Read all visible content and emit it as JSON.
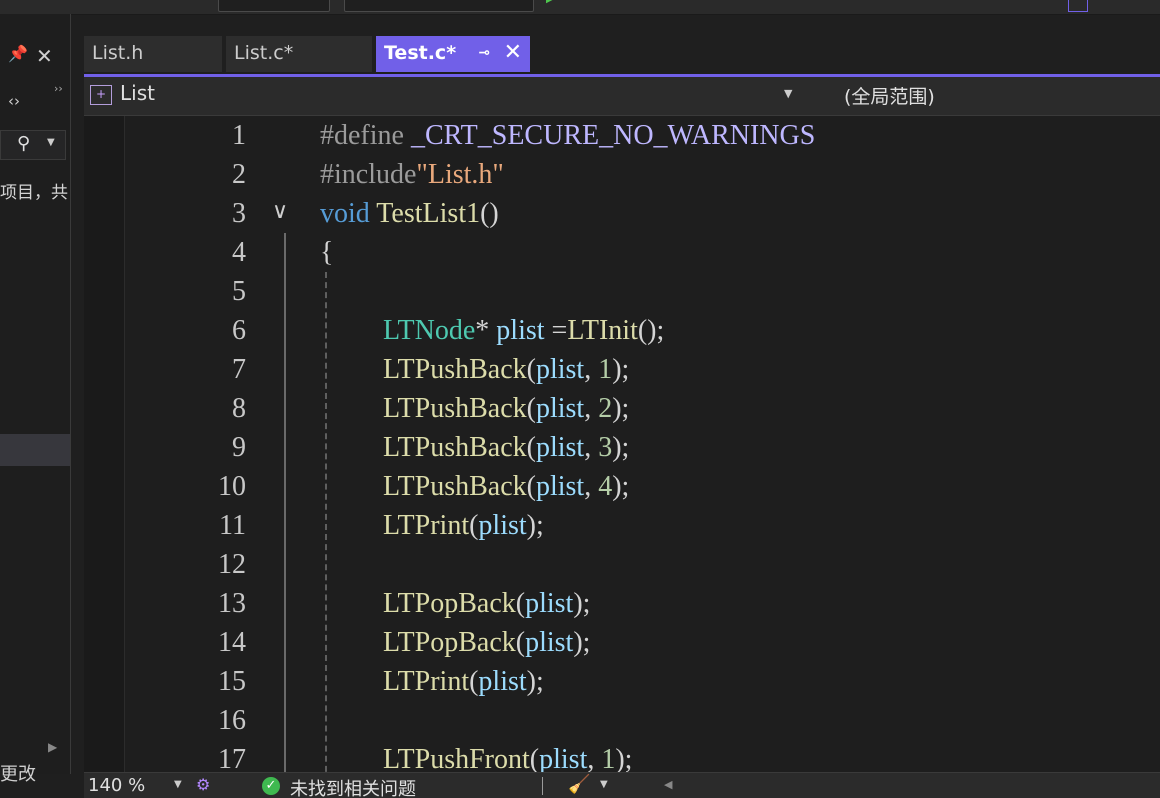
{
  "left_panel": {
    "text_line": "项目，共",
    "footer_text": "更改"
  },
  "tabs": [
    {
      "label": "List.h",
      "active": false
    },
    {
      "label": "List.c*",
      "active": false
    },
    {
      "label": "Test.c*",
      "active": true
    }
  ],
  "navbar": {
    "project": "List",
    "scope": "(全局范围)"
  },
  "editor": {
    "line_numbers": [
      "1",
      "2",
      "3",
      "4",
      "5",
      "6",
      "7",
      "8",
      "9",
      "10",
      "11",
      "12",
      "13",
      "14",
      "15",
      "16",
      "17"
    ]
  },
  "statusbar": {
    "zoom": "140 %",
    "issues": "未找到相关问题"
  },
  "colors": {
    "accent": "#7160e8",
    "ok": "#3fb950"
  }
}
